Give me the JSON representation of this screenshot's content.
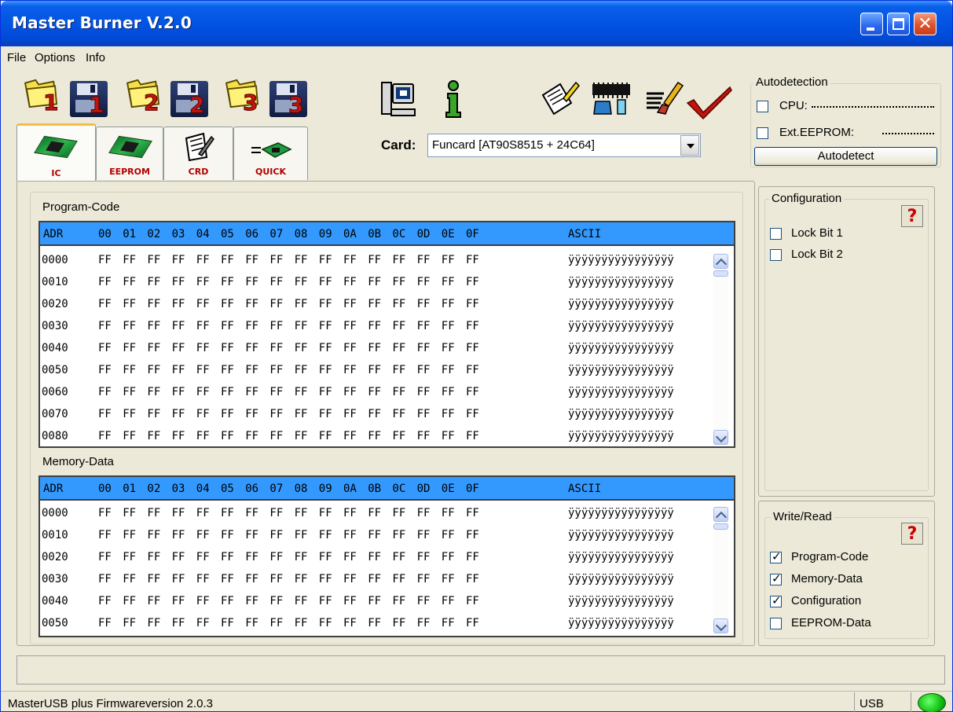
{
  "window": {
    "title": "Master Burner V.2.0"
  },
  "menu": [
    "File",
    "Options",
    "Info"
  ],
  "toolbar": {
    "open_labels": [
      "1",
      "2",
      "3"
    ],
    "save_labels": [
      "1",
      "2",
      "3"
    ]
  },
  "tabs": [
    {
      "label": "IC",
      "active": true
    },
    {
      "label": "EEPROM",
      "active": false
    },
    {
      "label": "CRD",
      "active": false
    },
    {
      "label": "QUICK",
      "active": false
    }
  ],
  "card": {
    "label": "Card:",
    "value": "Funcard [AT90S8515 + 24C64]"
  },
  "autodetection": {
    "title": "Autodetection",
    "cpu_label": "CPU:",
    "eeprom_label": "Ext.EEPROM:",
    "button": "Autodetect"
  },
  "configuration": {
    "title": "Configuration",
    "help": "?",
    "options": [
      {
        "label": "Lock Bit 1",
        "checked": false
      },
      {
        "label": "Lock Bit 2",
        "checked": false
      }
    ]
  },
  "write_read": {
    "title": "Write/Read",
    "help": "?",
    "options": [
      {
        "label": "Program-Code",
        "checked": true
      },
      {
        "label": "Memory-Data",
        "checked": true
      },
      {
        "label": "Configuration",
        "checked": true
      },
      {
        "label": "EEPROM-Data",
        "checked": false
      }
    ]
  },
  "hex": {
    "header_adr": "ADR",
    "columns": [
      "00",
      "01",
      "02",
      "03",
      "04",
      "05",
      "06",
      "07",
      "08",
      "09",
      "0A",
      "0B",
      "0C",
      "0D",
      "0E",
      "0F"
    ],
    "header_ascii": "ASCII",
    "byte_value": "FF",
    "ascii_value": "ÿÿÿÿÿÿÿÿÿÿÿÿÿÿÿÿ"
  },
  "program_code": {
    "title": "Program-Code",
    "addresses": [
      "0000",
      "0010",
      "0020",
      "0030",
      "0040",
      "0050",
      "0060",
      "0070",
      "0080"
    ]
  },
  "memory_data": {
    "title": "Memory-Data",
    "addresses": [
      "0000",
      "0010",
      "0020",
      "0030",
      "0040",
      "0050"
    ]
  },
  "status": {
    "firmware": "MasterUSB plus Firmwareversion 2.0.3",
    "connection": "USB",
    "led_color": "#11c311"
  }
}
